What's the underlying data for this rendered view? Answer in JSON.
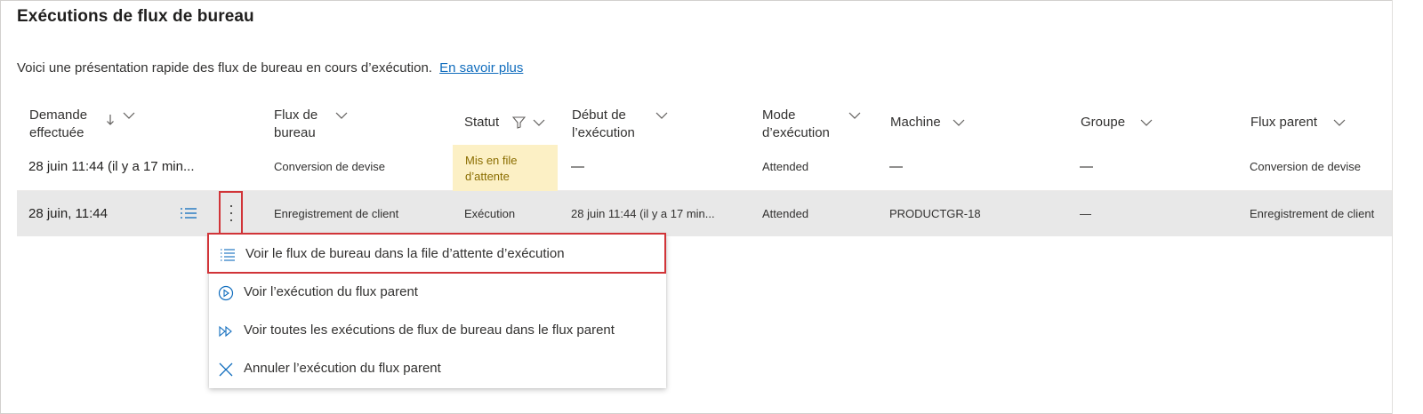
{
  "page": {
    "title": "Exécutions de flux de bureau",
    "subtitle": "Voici une présentation rapide des flux de bureau en cours d’exécution.",
    "learn_more": "En savoir plus"
  },
  "columns": {
    "requested_l1": "Demande",
    "requested_l2": "effectuée",
    "flow_l1": "Flux de",
    "flow_l2": "bureau",
    "status": "Statut",
    "start_l1": "Début de",
    "start_l2": "l’exécution",
    "mode_l1": "Mode",
    "mode_l2": "d’exécution",
    "machine": "Machine",
    "group": "Groupe",
    "parent": "Flux parent"
  },
  "rows": [
    {
      "requested": "28 juin 11:44 (il y a 17 min...",
      "flow": "Conversion de devise",
      "status_l1": "Mis en file",
      "status_l2": "d’attente",
      "start": "—",
      "mode": "Attended",
      "machine": "—",
      "group": "—",
      "parent": "Conversion de devise"
    },
    {
      "requested": "28 juin, 11:44",
      "flow": "Enregistrement de client",
      "status": "Exécution",
      "start": "28 juin 11:44 (il y a 17 min...",
      "mode": "Attended",
      "machine": "PRODUCTGR-18",
      "group": "—",
      "parent": "Enregistrement de client"
    }
  ],
  "context_menu": {
    "items": [
      {
        "label": "Voir le flux de bureau dans la file d’attente d’exécution",
        "icon": "queue-list-icon"
      },
      {
        "label": "Voir l’exécution du flux parent",
        "icon": "play-circle-icon"
      },
      {
        "label": "Voir toutes les exécutions de flux de bureau dans le flux parent",
        "icon": "fast-forward-icon"
      },
      {
        "label": "Annuler l’exécution du flux parent",
        "icon": "close-icon"
      }
    ]
  },
  "colors": {
    "accent": "#0f6cbd",
    "highlight_border": "#d13438",
    "queued_bg": "#fcf0c5",
    "selected_row_bg": "#e8e8e8"
  }
}
